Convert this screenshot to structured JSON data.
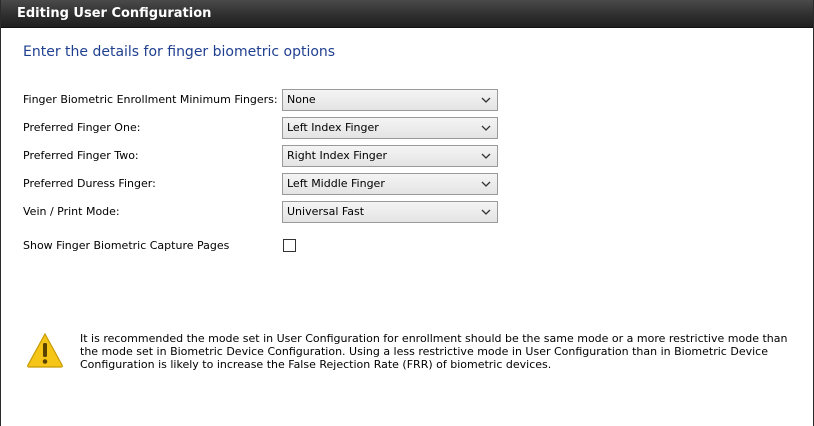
{
  "window": {
    "title": "Editing User Configuration"
  },
  "form": {
    "heading": "Enter the details for finger biometric options",
    "fields": [
      {
        "label": "Finger Biometric Enrollment Minimum Fingers:",
        "value": "None"
      },
      {
        "label": "Preferred Finger One:",
        "value": "Left Index Finger"
      },
      {
        "label": "Preferred Finger Two:",
        "value": "Right Index Finger"
      },
      {
        "label": "Preferred Duress Finger:",
        "value": "Left Middle Finger"
      },
      {
        "label": "Vein / Print Mode:",
        "value": "Universal Fast"
      }
    ],
    "capture_pages": {
      "label": "Show Finger Biometric Capture Pages",
      "checked": false
    }
  },
  "warning": {
    "icon": "warning-icon",
    "text": "It is recommended the mode set in User Configuration for enrollment should be the same mode or a more restrictive mode than the mode set in Biometric Device Configuration.  Using a less restrictive mode in User Configuration than in Biometric Device Configuration is likely to increase the False Rejection Rate (FRR) of biometric devices."
  },
  "colors": {
    "heading": "#1f3f8f",
    "warning_fill": "#f5c518",
    "titlebar": "#2f2f2f"
  }
}
